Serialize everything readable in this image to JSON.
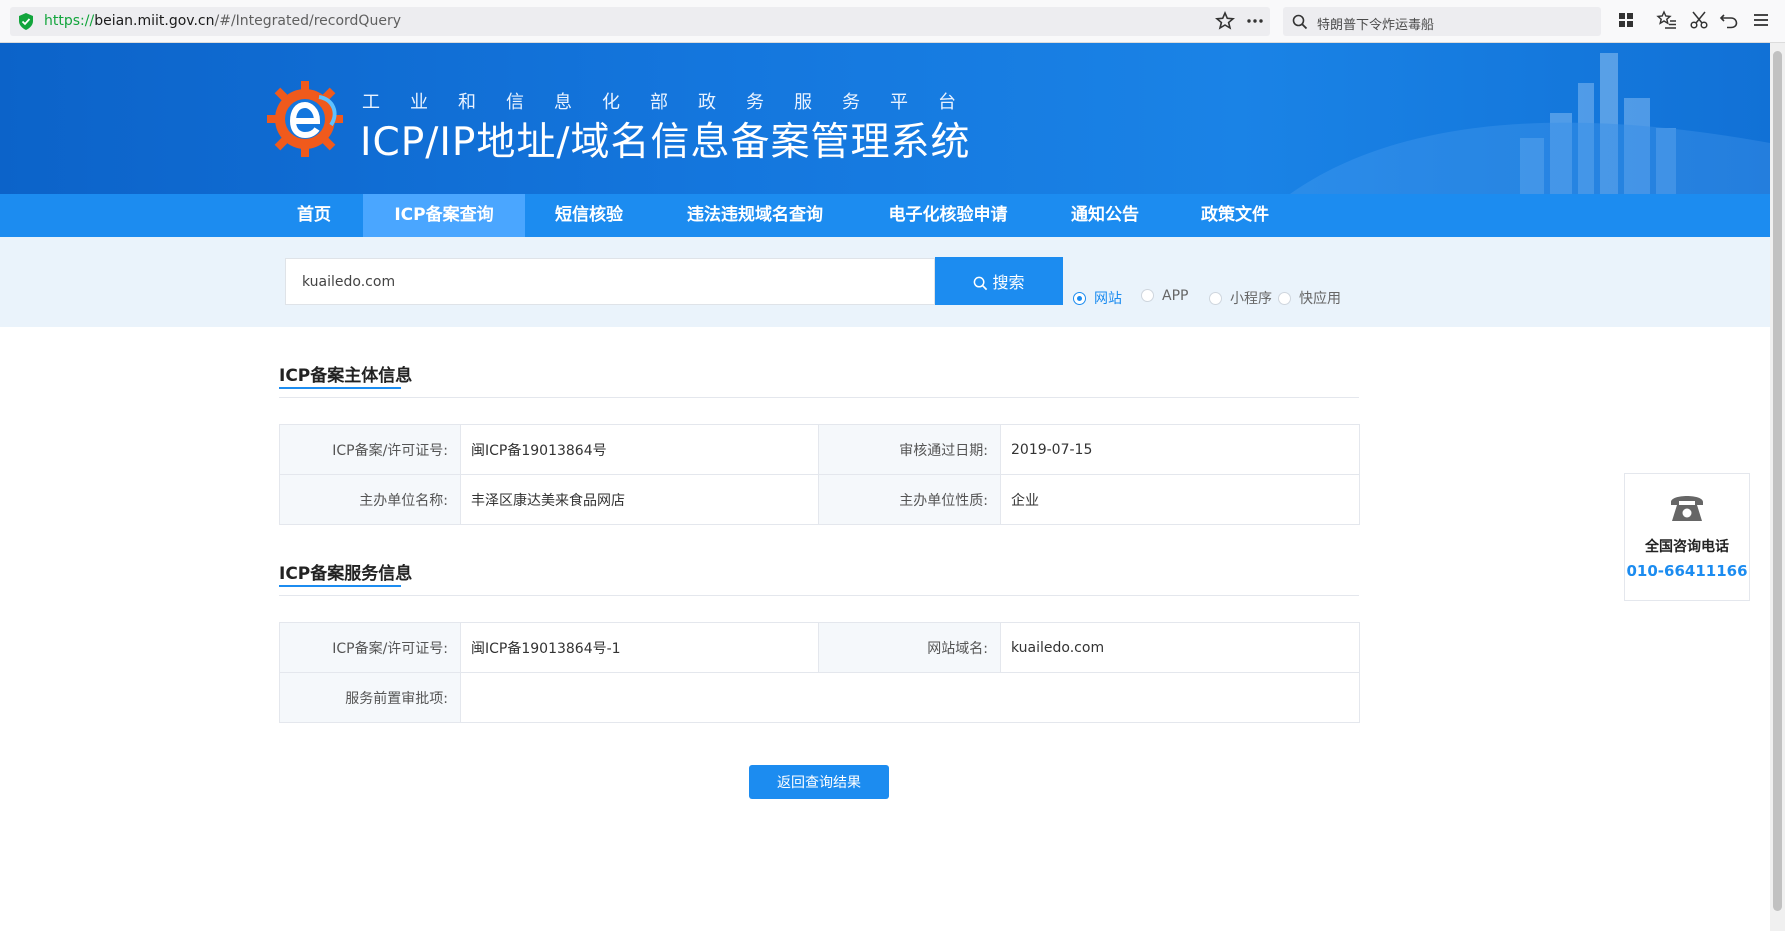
{
  "browser": {
    "url_scheme": "https://",
    "url_host": "beian.miit.gov.cn",
    "url_path": "/#/Integrated/recordQuery",
    "search_text": "特朗普下令炸运毒船"
  },
  "header": {
    "subtitle": "工业和信息化部政务服务平台",
    "title": "ICP/IP地址/域名信息备案管理系统"
  },
  "nav": {
    "items": [
      {
        "label": "首页"
      },
      {
        "label": "ICP备案查询"
      },
      {
        "label": "短信核验"
      },
      {
        "label": "违法违规域名查询"
      },
      {
        "label": "电子化核验申请"
      },
      {
        "label": "通知公告"
      },
      {
        "label": "政策文件"
      }
    ],
    "active_index": 1
  },
  "search": {
    "value": "kuailedo.com",
    "button_label": "搜索",
    "options": [
      {
        "label": "网站",
        "checked": true
      },
      {
        "label": "APP",
        "checked": false
      },
      {
        "label": "小程序",
        "checked": false
      },
      {
        "label": "快应用",
        "checked": false
      }
    ]
  },
  "subject_info": {
    "title": "ICP备案主体信息",
    "rows": [
      {
        "k1": "ICP备案/许可证号:",
        "v1": "闽ICP备19013864号",
        "k2": "审核通过日期:",
        "v2": "2019-07-15"
      },
      {
        "k1": "主办单位名称:",
        "v1": "丰泽区康达美来食品网店",
        "k2": "主办单位性质:",
        "v2": "企业"
      }
    ]
  },
  "service_info": {
    "title": "ICP备案服务信息",
    "row1": {
      "k1": "ICP备案/许可证号:",
      "v1": "闽ICP备19013864号-1",
      "k2": "网站域名:",
      "v2": "kuailedo.com"
    },
    "row2": {
      "k1": "服务前置审批项:",
      "v1": ""
    }
  },
  "back_button": "返回查询结果",
  "hotline": {
    "label": "全国咨询电话",
    "phone": "010-66411166"
  },
  "colors": {
    "primary": "#1c8cf0",
    "banner": "#1476dd",
    "strip": "#eaf3fb"
  }
}
